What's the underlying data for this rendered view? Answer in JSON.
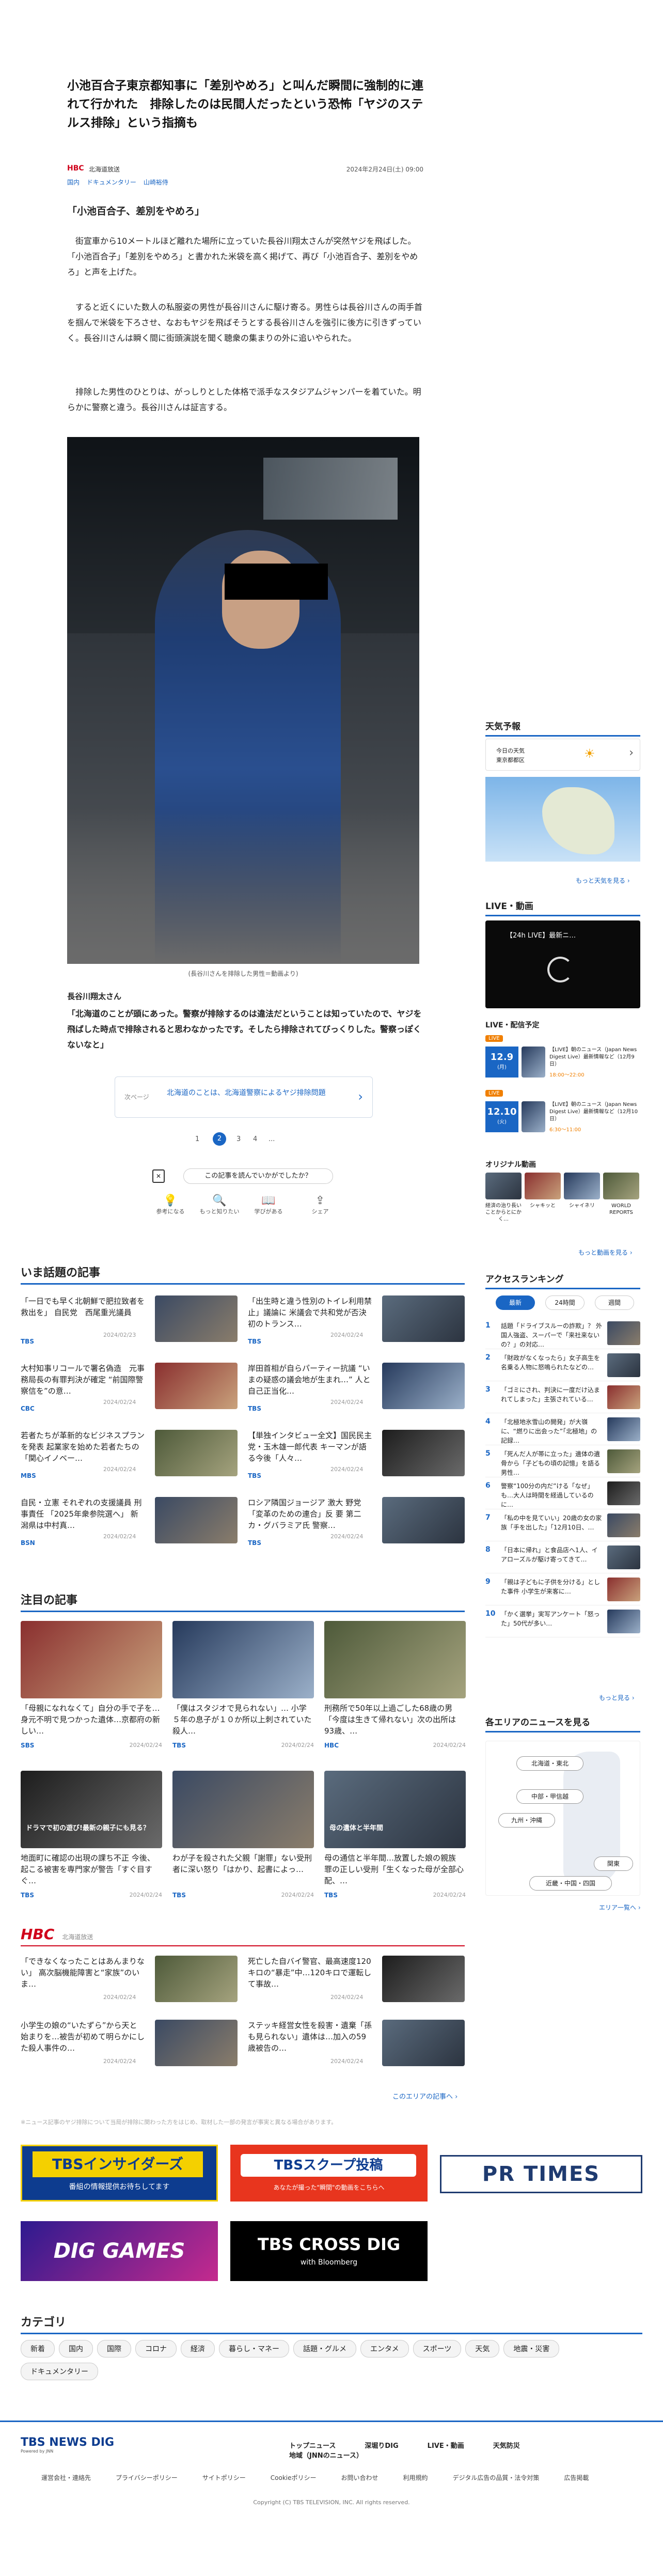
{
  "article": {
    "title": "小池百合子東京都知事に「差別やめろ」と叫んだ瞬間に強制的に連れて行かれた　排除したのは民間人だったという恐怖「ヤジのステルス排除」という指摘も",
    "source_logo": "HBC",
    "source": "北海道放送",
    "date": "2024年2月24日(土) 09:00",
    "tags": [
      "国内",
      "ドキュメンタリー",
      "山崎裕侍"
    ],
    "subhead": "「小池百合子、差別をやめろ」",
    "p1": "　街宣車から10メートルほど離れた場所に立っていた長谷川翔太さんが突然ヤジを飛ばした。「小池百合子」「差別をやめろ」と書かれた米袋を高く掲げて、再び「小池百合子、差別をやめろ」と声を上げた。",
    "p2": "　すると近くにいた数人の私服姿の男性が長谷川さんに駆け寄る。男性らは長谷川さんの両手首を掴んで米袋を下ろさせ、なおもヤジを飛ばそうとする長谷川さんを強引に後方に引きずっていく。長谷川さんは瞬く間に街頭演説を聞く聴衆の集まりの外に追いやられた。",
    "p3": "　排除した男性のひとりは、がっしりとした体格で派手なスタジアムジャンパーを着ていた。明らかに警察と違う。長谷川さんは証言する。",
    "caption": "(長谷川さんを排除した男性＝動画より)",
    "speaker": "長谷川翔太さん",
    "quote": "「北海道のことが頭にあった。警察が排除するのは違法だということは知っていたので、ヤジを飛ばした時点で排除されると思わなかったです。そしたら排除されてびっくりした。警察っぽくないなと」",
    "next_label": "次ページ",
    "next_text": "北海道のことは、北海道警察によるヤジ排除問題",
    "pages": [
      "1",
      "2",
      "3",
      "4",
      "..."
    ],
    "feedback_q": "この記事を読んでいかがでしたか？",
    "reactions": [
      "参考になる",
      "もっと知りたい",
      "学びがある",
      "シェア"
    ]
  },
  "popular": {
    "title": "いま話題の記事",
    "items": [
      {
        "t": "「一日でも早く北朝鮮で肥拉致者を救出を」 自民党　西尾重光議員",
        "d": "2024/02/23",
        "b": "TBS"
      },
      {
        "t": "「出生時と違う性別のトイレ利用禁止」議論に 米議会で共和党が否決 初のトランス…",
        "d": "2024/02/24",
        "b": "TBS"
      },
      {
        "t": "大村知事リコールで署名偽造　元事務局長の有罪判決が確定 “前国際警察信を”の意…",
        "d": "2024/02/24",
        "b": "CBC"
      },
      {
        "t": "岸田首相が自らパーティー抗議 “いまの疑惑の議会地が生まれ…” 人と自己正当化…",
        "d": "2024/02/24",
        "b": "TBS"
      },
      {
        "t": "若者たちが革新的なビジネスプランを発表 起業家を始めた若者たちの「関心イノベー…",
        "d": "2024/02/24",
        "b": "MBS"
      },
      {
        "t": "【単独インタビュー全文】国民民主党・玉木雄一郎代表 キーマンが語る今後「人々…",
        "d": "2024/02/24",
        "b": "TBS"
      },
      {
        "t": "自民・立憲 それぞれの支援議員 刑事責任 「2025年衆参院選へ」 新潟県は中村真…",
        "d": "2024/02/24",
        "b": "BSN"
      },
      {
        "t": "ロシア隣国ジョージア 激大 野党「変革のための連合」反 要 第二カ・グバラミア氏 警察…",
        "d": "2024/02/24",
        "b": "TBS"
      }
    ]
  },
  "featured": {
    "title": "注目の記事",
    "items": [
      {
        "t": "「母親になれなくて」自分の手で子を…身元不明で見つかった遺体…京都府の新しい…",
        "d": "2024/02/24",
        "b": "SBS"
      },
      {
        "t": "「僕はスタジオで見られない」… 小学５年の息子が１０か所以上刺されていた殺人…",
        "d": "2024/02/24",
        "b": "TBS"
      },
      {
        "t": "刑務所で50年以上過ごした68歳の男「今度は生きて帰れない」次の出所は93歳、…",
        "d": "2024/02/24",
        "b": "HBC"
      },
      {
        "t": "地面町に確認の出現の課ち不正 今後、起こる被害を専門家が警告「すぐ目すぐ…",
        "d": "2024/02/24",
        "b": "TBS"
      },
      {
        "t": "わが子を殺された父親「謝罪」ない受刑者に深い怒り「はかり、起書によっ…",
        "d": "2024/02/24",
        "b": "TBS"
      },
      {
        "t": "母の通信と半年間…放置した娘の親族 罪の正しい受刑「生くなった母が全部心配、…",
        "d": "2024/02/24",
        "b": "TBS"
      }
    ],
    "banners": [
      "",
      "",
      "",
      "ドラマで初の遊び!最新の親子にも見る？",
      "",
      "母の遺体と半年間"
    ]
  },
  "hbc": {
    "logo": "HBC",
    "brand": "北海道放送",
    "items": [
      {
        "t": "「できなくなったことはあんまりない」 高次脳機能障害と“家族”のいま…",
        "d": "2024/02/24"
      },
      {
        "t": "死亡した自バイ警官、最高速度120キロの“暴走”中…120キロで運転して事故…",
        "d": "2024/02/24"
      },
      {
        "t": "小学生の娘の“いたずら”から天と始まりを…被告が初めて明らかにした殺人事件の…",
        "d": "2024/02/24"
      },
      {
        "t": "ステッキ経営女性を殺害・遺棄「孫も見られない」遺体は…加入の59歳被告の…",
        "d": "2024/02/24"
      }
    ],
    "more": "このエリアの記事へ ›"
  },
  "notice": "※ニュース記事のヤジ排除について当局が排除に関わった方をはじめ、取材した一部の発言が事実と異なる場合があります。",
  "banners": {
    "b1_title": "TBSインサイダーズ",
    "b1_sub": "番組の情報提供お待ちしてます",
    "b2_title": "TBSスクープ投稿",
    "b2_sub": "あなたが撮った\"瞬間\"の動画をこちらへ",
    "b3_title": "PR TIMES",
    "b4_title": "DIG GAMES",
    "b5_title": "TBS CROSS DIG",
    "b5_sub": "with Bloomberg"
  },
  "category": {
    "title": "カテゴリ",
    "items": [
      "新着",
      "国内",
      "国際",
      "コロナ",
      "経済",
      "暮らし・マネー",
      "話題・グルメ",
      "エンタメ",
      "スポーツ",
      "天気",
      "地震・災害",
      "ドキュメンタリー"
    ]
  },
  "footer": {
    "logo": "TBS NEWS DIG",
    "logo_sub": "Powered by JNN",
    "nav": [
      "トップニュース",
      "深堀りDIG",
      "LIVE・動画",
      "天気防災",
      "地域（JNNのニュース）"
    ],
    "links": [
      "運営会社・連絡先",
      "プライバシーポリシー",
      "サイトポリシー",
      "Cookieポリシー",
      "お問い合わせ",
      "利用規約",
      "デジタル広告の品質・法令対策",
      "広告掲載"
    ],
    "copyright": "Copyright (C) TBS TELEVISION, INC. All rights reserved."
  },
  "sidebar": {
    "weather_title": "天気予報",
    "weather_label": "今日の天気",
    "weather_region": "東京都都区",
    "weather_more": "もっと天気を見る ›",
    "live_title": "LIVE・動画",
    "live_card": "【24h LIVE】最新ニ…",
    "schedule_title": "LIVE・配信予定",
    "schedule": [
      {
        "date": "12.9",
        "day": "(月)",
        "badge": "LIVE",
        "t": "【LIVE】朝のニュース（Japan News Digest Live）最新情報など（12月9日）",
        "time": "18:00〜22:00"
      },
      {
        "date": "12.10",
        "day": "(火)",
        "badge": "LIVE",
        "t": "【LIVE】朝のニュース（Japan News Digest Live）最新情報など（12月10日）",
        "time": "6:30〜11:00"
      }
    ],
    "orig_title": "オリジナル動画",
    "orig_items": [
      "経済の治り長いことからとにかく…",
      "シャキッと",
      "シャイネリ",
      "WORLD REPORTS"
    ],
    "orig_more": "もっと動画を見る ›",
    "ranking_title": "アクセスランキング",
    "ranking_tabs": [
      "最新",
      "24時間",
      "週間"
    ],
    "ranking": [
      "話題「ドライブスルーの詐欺」？ 外国人強盗、スーパーで「来社来ないの？」の対応…",
      "「財政がなくなったら」女子高生を名乗る人物に怒鳴られたなどの…",
      "「ゴミにされ、判決に一度だけ込まれてしまった」主張されている…",
      "「北極地氷雪山の開発」が大嶺に、“燃りに出会った”「北極地」の記録…",
      "「死んだ人が帯に立った」遺体の遺骨から「子どもの頃の記憶」を語る男性…",
      "警察“100分の内だ”ける「なぜ」も…大人は時間を経過しているのに…",
      "「私の中を見ていい」20歳の女の家族「手を出した」「12月10日、…",
      "「日本に帰れ」と食品店へ1人、イアローズルが駆け寄ってきて…",
      "「親は子どもに子供を分ける」とした事件 小学生が来客に…",
      "「かく選挙」実写アンケート「怒った」50代が多い…"
    ],
    "ranking_more": "もっと見る ›",
    "area_title": "各エリアのニュースを見る",
    "areas": [
      "北海道・東北",
      "中部・甲信越",
      "九州・沖縄",
      "関東",
      "近畿・中国・四国"
    ],
    "area_more": "エリア一覧へ ›"
  }
}
